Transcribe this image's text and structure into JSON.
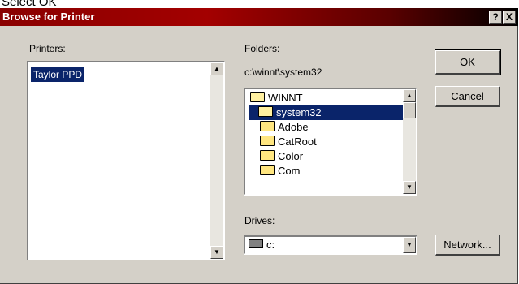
{
  "caption": "Select OK",
  "window": {
    "title": "Browse for Printer",
    "help_glyph": "?",
    "close_glyph": "X"
  },
  "printers": {
    "label": "Printers:",
    "items": [
      "Taylor PPD"
    ]
  },
  "folders": {
    "label": "Folders:",
    "current_path": "c:\\winnt\\system32",
    "items": [
      "WINNT",
      "system32",
      "Adobe",
      "CatRoot",
      "Color",
      "Com"
    ]
  },
  "drives": {
    "label": "Drives:",
    "selected": "c:"
  },
  "buttons": {
    "ok": "OK",
    "cancel": "Cancel",
    "network": "Network..."
  }
}
